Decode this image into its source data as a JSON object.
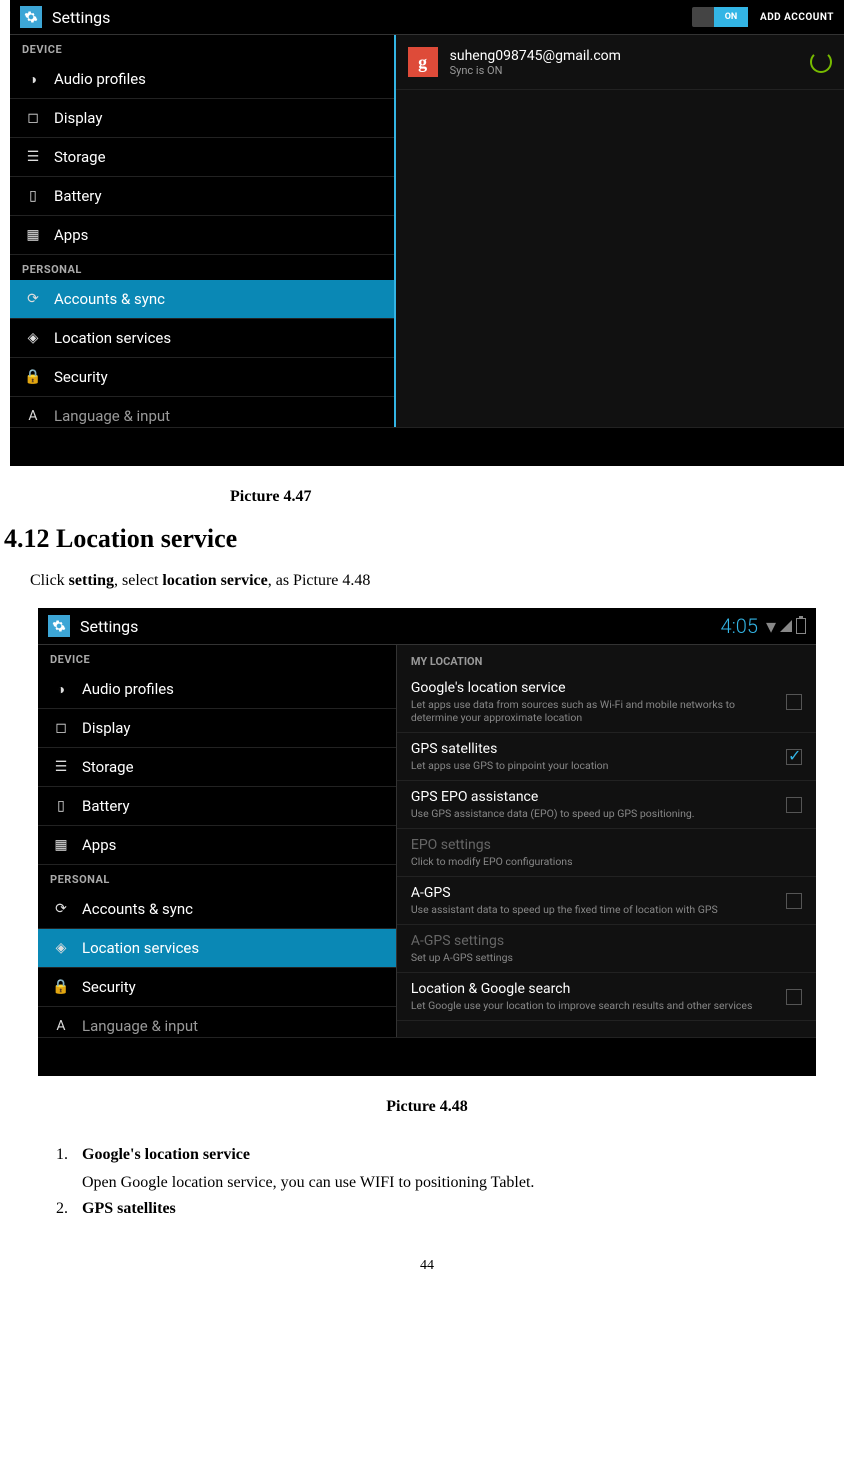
{
  "screenshot1": {
    "title": "Settings",
    "toggleLabel": "ON",
    "addAccount": "ADD ACCOUNT",
    "sidebar": {
      "sectionDevice": "DEVICE",
      "sectionPersonal": "PERSONAL",
      "items": {
        "audio": "Audio profiles",
        "display": "Display",
        "storage": "Storage",
        "battery": "Battery",
        "apps": "Apps",
        "accounts": "Accounts & sync",
        "location": "Location services",
        "security": "Security",
        "language": "Language & input"
      }
    },
    "account": {
      "email": "suheng098745@gmail.com",
      "sync": "Sync is ON"
    }
  },
  "caption1": "Picture 4.47",
  "heading": "4.12 Location service",
  "intro": {
    "pre": "Click ",
    "b1": "setting",
    "mid": ", select ",
    "b2": "location service",
    "post": ", as Picture 4.48"
  },
  "screenshot2": {
    "title": "Settings",
    "time": "4:05",
    "sidebar": {
      "sectionDevice": "DEVICE",
      "sectionPersonal": "PERSONAL",
      "items": {
        "audio": "Audio profiles",
        "display": "Display",
        "storage": "Storage",
        "battery": "Battery",
        "apps": "Apps",
        "accounts": "Accounts & sync",
        "location": "Location services",
        "security": "Security",
        "language": "Language & input"
      }
    },
    "prefs": {
      "header": "MY LOCATION",
      "google": {
        "t": "Google's location service",
        "s": "Let apps use data from sources such as Wi-Fi and mobile networks to determine your approximate location"
      },
      "gps": {
        "t": "GPS satellites",
        "s": "Let apps use GPS to pinpoint your location"
      },
      "epo": {
        "t": "GPS EPO assistance",
        "s": "Use GPS assistance data (EPO) to speed up GPS positioning."
      },
      "eposet": {
        "t": "EPO settings",
        "s": "Click to modify EPO configurations"
      },
      "agps": {
        "t": "A-GPS",
        "s": "Use assistant data to speed up the fixed time of location with GPS"
      },
      "agpsset": {
        "t": "A-GPS settings",
        "s": "Set up A-GPS settings"
      },
      "search": {
        "t": "Location & Google search",
        "s": "Let Google use your location to improve search results and other services"
      }
    }
  },
  "caption2": "Picture 4.48",
  "list": {
    "item1": {
      "t": "Google's location service",
      "b": "Open Google location service, you can use WIFI to positioning Tablet."
    },
    "item2": {
      "t": "GPS satellites"
    }
  },
  "pageNumber": "44"
}
